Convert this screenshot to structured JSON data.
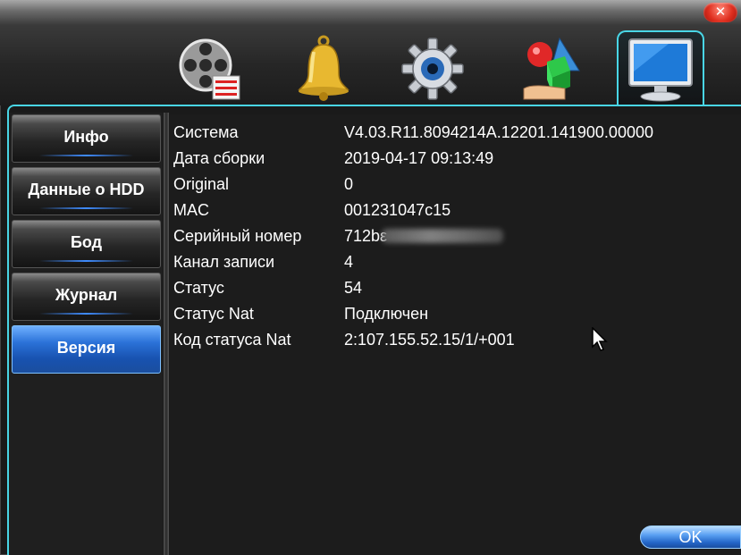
{
  "window": {
    "close_label": "✕"
  },
  "tabs": [
    {
      "icon": "film-reel-icon"
    },
    {
      "icon": "bell-icon"
    },
    {
      "icon": "gear-icon"
    },
    {
      "icon": "shapes-icon"
    },
    {
      "icon": "monitor-icon",
      "active": true
    }
  ],
  "sidebar": {
    "items": [
      {
        "label": "Инфо"
      },
      {
        "label": "Данные о HDD"
      },
      {
        "label": "Бод"
      },
      {
        "label": "Журнал"
      },
      {
        "label": "Версия",
        "active": true
      }
    ]
  },
  "info": {
    "rows": [
      {
        "label": "Система",
        "value": "V4.03.R11.8094214A.12201.141900.00000"
      },
      {
        "label": "Дата сборки",
        "value": "2019-04-17 09:13:49"
      },
      {
        "label": "Original",
        "value": "0"
      },
      {
        "label": "MAC",
        "value": "001231047c15"
      },
      {
        "label": "Серийный номер",
        "value": "712bε"
      },
      {
        "label": "Канал записи",
        "value": "4"
      },
      {
        "label": "Статус",
        "value": "54"
      },
      {
        "label": "Статус Nat",
        "value": "Подключен"
      },
      {
        "label": "Код статуса Nat",
        "value": "2:107.155.52.15/1/+001"
      }
    ]
  },
  "footer": {
    "ok_label": "OK"
  },
  "colors": {
    "accent": "#49d6e6",
    "active_nav": "#2b72d8"
  }
}
